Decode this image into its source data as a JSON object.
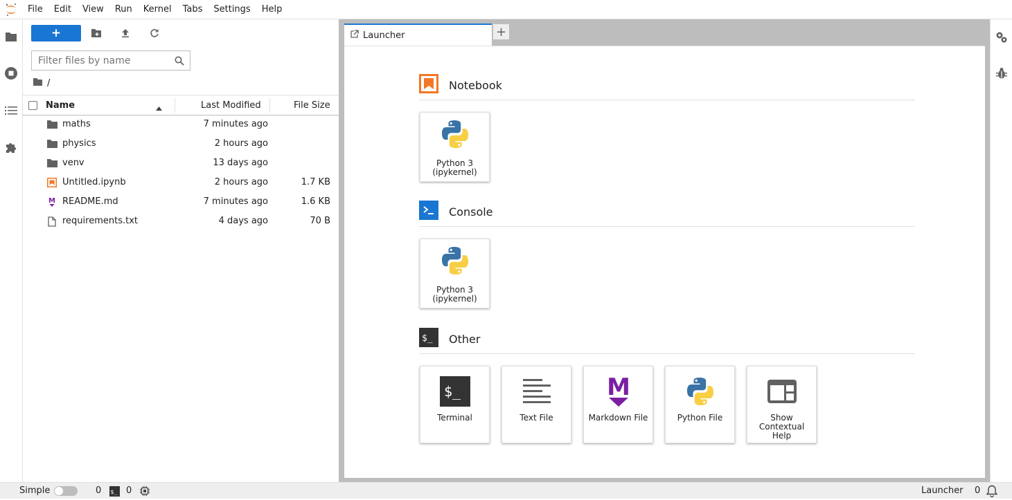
{
  "menu": [
    "File",
    "Edit",
    "View",
    "Run",
    "Kernel",
    "Tabs",
    "Settings",
    "Help"
  ],
  "filebrowser": {
    "new_label": "+",
    "filter_placeholder": "Filter files by name",
    "breadcrumb": "/",
    "columns": {
      "name": "Name",
      "modified": "Last Modified",
      "size": "File Size"
    },
    "files": [
      {
        "name": "maths",
        "modified": "7 minutes ago",
        "size": "",
        "icon": "folder-icon"
      },
      {
        "name": "physics",
        "modified": "2 hours ago",
        "size": "",
        "icon": "folder-icon"
      },
      {
        "name": "venv",
        "modified": "13 days ago",
        "size": "",
        "icon": "folder-icon"
      },
      {
        "name": "Untitled.ipynb",
        "modified": "2 hours ago",
        "size": "1.7 KB",
        "icon": "notebook-icon"
      },
      {
        "name": "README.md",
        "modified": "7 minutes ago",
        "size": "1.6 KB",
        "icon": "markdown-icon"
      },
      {
        "name": "requirements.txt",
        "modified": "4 days ago",
        "size": "70 B",
        "icon": "text-file-icon"
      }
    ]
  },
  "tabs": {
    "launcher": "Launcher",
    "add": "+"
  },
  "launcher": {
    "notebook": {
      "title": "Notebook",
      "cards": [
        {
          "label": "Python 3 (ipykernel)"
        }
      ]
    },
    "console": {
      "title": "Console",
      "cards": [
        {
          "label": "Python 3 (ipykernel)"
        }
      ]
    },
    "other": {
      "title": "Other",
      "cards": [
        {
          "label": "Terminal"
        },
        {
          "label": "Text File"
        },
        {
          "label": "Markdown File"
        },
        {
          "label": "Python File"
        },
        {
          "label": "Show Contextual Help"
        }
      ]
    }
  },
  "statusbar": {
    "mode": "Simple",
    "kernels": "0",
    "terminals": "0",
    "right_label": "Launcher",
    "notifications": "0"
  },
  "colors": {
    "accent": "#1976d2",
    "notebook_orange": "#f37726",
    "markdown_purple": "#7b1fa2"
  }
}
